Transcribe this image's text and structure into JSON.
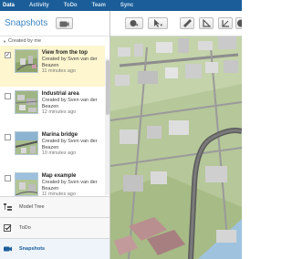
{
  "nav": {
    "tabs": [
      {
        "label": "Data",
        "active": true
      },
      {
        "label": "Activity",
        "active": false
      },
      {
        "label": "ToDo",
        "active": false
      },
      {
        "label": "Team",
        "active": false
      },
      {
        "label": "Sync",
        "active": false
      }
    ]
  },
  "panel": {
    "title": "Snapshots",
    "camera_icon": "camera-icon",
    "sort_label": "Created by me"
  },
  "snapshots": [
    {
      "title": "View from the top",
      "created_by": "Created by Sven van der Beazen",
      "ago": "11 minutes ago",
      "checked": true,
      "selected": true
    },
    {
      "title": "Industrial area",
      "created_by": "Created by Sven van der Beazen",
      "ago": "12 minutes ago",
      "checked": false,
      "selected": false
    },
    {
      "title": "Marina bridge",
      "created_by": "Created by Sven van der Beazen",
      "ago": "10 minutes ago",
      "checked": false,
      "selected": false
    },
    {
      "title": "Map example",
      "created_by": "Created by Sven van der Beazen",
      "ago": "11 minutes ago",
      "checked": false,
      "selected": false
    }
  ],
  "sections": [
    {
      "label": "Model Tree",
      "icon": "tree-icon",
      "active": false
    },
    {
      "label": "ToDo",
      "icon": "checkbox-icon",
      "active": false
    },
    {
      "label": "Snapshots",
      "icon": "camera-icon",
      "active": true
    }
  ],
  "toolbar": {
    "icons": [
      "hand-icon",
      "cursor-icon",
      "ruler-icon",
      "measure-icon",
      "angle-icon",
      "globe-icon"
    ]
  },
  "colors": {
    "nav_bg": "#1a5d99",
    "accent": "#3f86c4",
    "selected_row": "#fdf6cf",
    "terrain": "#b9c99c"
  }
}
